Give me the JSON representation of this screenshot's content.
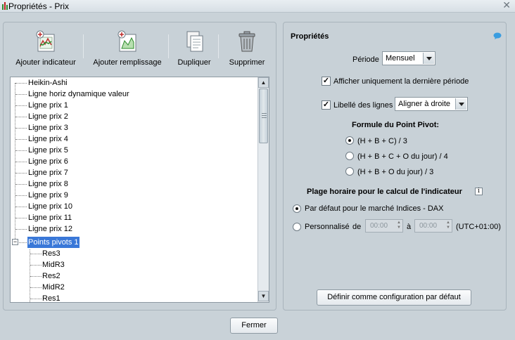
{
  "window": {
    "title": "Propriétés - Prix",
    "close_glyph": "✕"
  },
  "toolbar": {
    "add_indicator": "Ajouter indicateur",
    "add_fill": "Ajouter remplissage",
    "duplicate": "Dupliquer",
    "delete": "Supprimer"
  },
  "tree": {
    "items": [
      "Heikin-Ashi",
      "Ligne horiz dynamique valeur",
      "Ligne prix 1",
      "Ligne prix 2",
      "Ligne prix 3",
      "Ligne prix 4",
      "Ligne prix 5",
      "Ligne prix 6",
      "Ligne prix 7",
      "Ligne prix 8",
      "Ligne prix 9",
      "Ligne prix 10",
      "Ligne prix 11",
      "Ligne prix 12",
      "Points pivots 1"
    ],
    "children": [
      "Res3",
      "MidR3",
      "Res2",
      "MidR2",
      "Res1"
    ],
    "selected_index": 14,
    "expander_glyph": "−"
  },
  "properties": {
    "title": "Propriétés",
    "period_label": "Période",
    "period_value": "Mensuel",
    "only_last_period_label": "Afficher uniquement la dernière période",
    "only_last_period_checked": true,
    "line_labels_label": "Libellé des lignes",
    "line_labels_checked": true,
    "line_labels_value": "Aligner à droite",
    "pivot_formula_title": "Formule du Point Pivot:",
    "pivot_options": [
      "(H + B + C) / 3",
      "(H + B + C + O du jour) / 4",
      "(H + B + O du jour) / 3"
    ],
    "pivot_selected": 0,
    "time_range_title": "Plage horaire pour le calcul de l'indicateur",
    "info_glyph": "i",
    "default_market_label": "Par défaut pour le marché Indices - DAX",
    "custom_label": "Personnalisé",
    "from_label": "de",
    "from_value": "00:00",
    "to_label": "à",
    "to_value": "00:00",
    "timezone": "(UTC+01:00)",
    "time_range_selected": "default",
    "set_default_button": "Définir comme configuration par défaut"
  },
  "footer": {
    "close_button": "Fermer"
  },
  "check_glyph": "✓"
}
